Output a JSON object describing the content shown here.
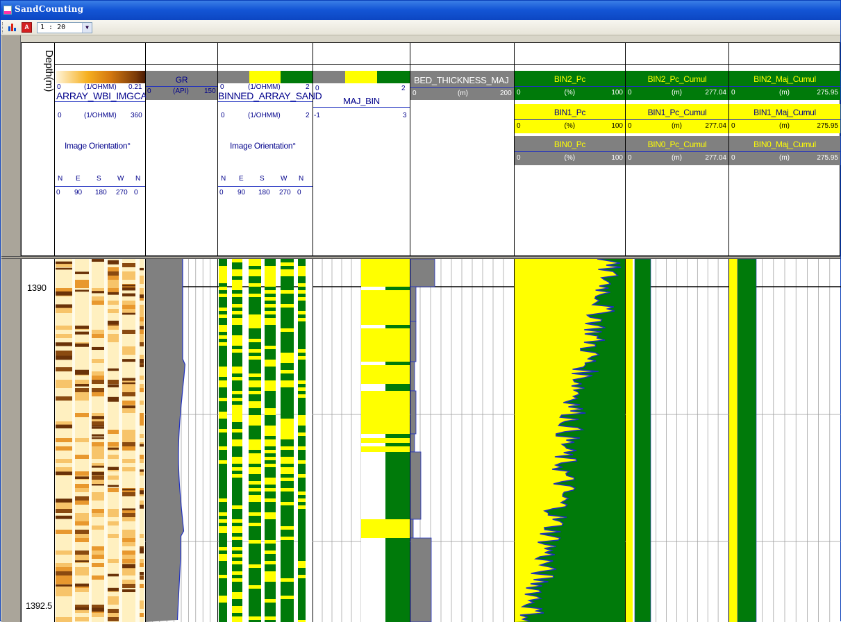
{
  "window": {
    "title": "SandCounting",
    "scale": "1 : 20",
    "pdf_icon_text": "A"
  },
  "depth_header": "Depth(m)",
  "tracks": {
    "imgcal": {
      "name": "ARRAY_WBI_IMGCAL",
      "unit": "(1/OHMM)",
      "min": "0",
      "max": "0.21",
      "orient_unit": "(1/OHMM)",
      "orient_min": "0",
      "orient_max": "360",
      "orient_label": "Image Orientation°",
      "compass": [
        "N",
        "E",
        "S",
        "W",
        "N"
      ],
      "degrees": [
        "0",
        "90",
        "180",
        "270",
        "0"
      ]
    },
    "gr": {
      "name": "GR",
      "unit": "(API)",
      "min": "0",
      "max": "150"
    },
    "binned": {
      "name": "BINNED_ARRAY_SAND",
      "unit": "(1/OHMM)",
      "min": "0",
      "max": "2",
      "orient_unit": "(1/OHMM)",
      "orient_min": "0",
      "orient_max": "2",
      "orient_label": "Image Orientation°",
      "compass": [
        "N",
        "E",
        "S",
        "W",
        "N"
      ],
      "degrees": [
        "0",
        "90",
        "180",
        "270",
        "0"
      ]
    },
    "majbin": {
      "name": "MAJ_BIN",
      "min": "0",
      "max": "2",
      "min2": "-1",
      "max2": "3"
    },
    "bed": {
      "name": "BED_THICKNESS_MAJ",
      "unit": "(m)",
      "min": "0",
      "max": "200"
    },
    "pc": [
      {
        "name": "BIN2_Pc",
        "unit": "(%)",
        "min": "0",
        "max": "100"
      },
      {
        "name": "BIN1_Pc",
        "unit": "(%)",
        "min": "0",
        "max": "100"
      },
      {
        "name": "BIN0_Pc",
        "unit": "(%)",
        "min": "0",
        "max": "100"
      }
    ],
    "pc_cumul": [
      {
        "name": "BIN2_Pc_Cumul",
        "unit": "(m)",
        "min": "0",
        "max": "277.04"
      },
      {
        "name": "BIN1_Pc_Cumul",
        "unit": "(m)",
        "min": "0",
        "max": "277.04"
      },
      {
        "name": "BIN0_Pc_Cumul",
        "unit": "(m)",
        "min": "0",
        "max": "277.04"
      }
    ],
    "maj_cumul": [
      {
        "name": "BIN2_Maj_Cumul",
        "unit": "(m)",
        "min": "0",
        "max": "275.95"
      },
      {
        "name": "BIN1_Maj_Cumul",
        "unit": "(m)",
        "min": "0",
        "max": "275.95"
      },
      {
        "name": "BIN0_Maj_Cumul",
        "unit": "(m)",
        "min": "0",
        "max": "275.95"
      }
    ]
  },
  "depths": {
    "top": "1390",
    "bottom": "1392.5"
  },
  "colors": {
    "bin2": "#007a0a",
    "bin1": "#ffff00",
    "bin0": "#808080",
    "curve": "#2030c0",
    "imgcal_light": "#fff2c8",
    "imgcal_dark": "#7a3a08"
  }
}
